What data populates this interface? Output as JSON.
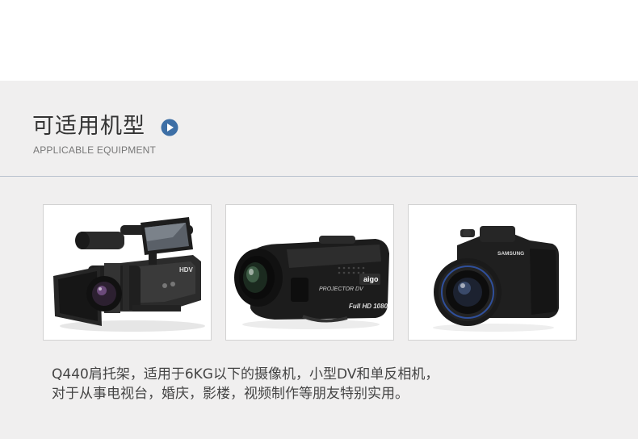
{
  "section": {
    "title": "可适用机型",
    "subtitle": "APPLICABLE EQUIPMENT"
  },
  "products": [
    {
      "icon": "pro-camcorder-image",
      "screen_label": "HDV"
    },
    {
      "icon": "projector-dv-image",
      "brand": "aigo",
      "model": "PROJECTOR DV",
      "badge": "Full HD 1080"
    },
    {
      "icon": "dslr-camera-image",
      "brand": "SAMSUNG"
    }
  ],
  "description": {
    "line1": "Q440肩托架，适用于6KG以下的摄像机，小型DV和单反相机，",
    "line2": "对于从事电视台，婚庆，影楼，视频制作等朋友特别实用。"
  },
  "colors": {
    "panel_bg": "#f0efef",
    "accent": "#3d6fa6",
    "divider": "#b9c3cf"
  }
}
